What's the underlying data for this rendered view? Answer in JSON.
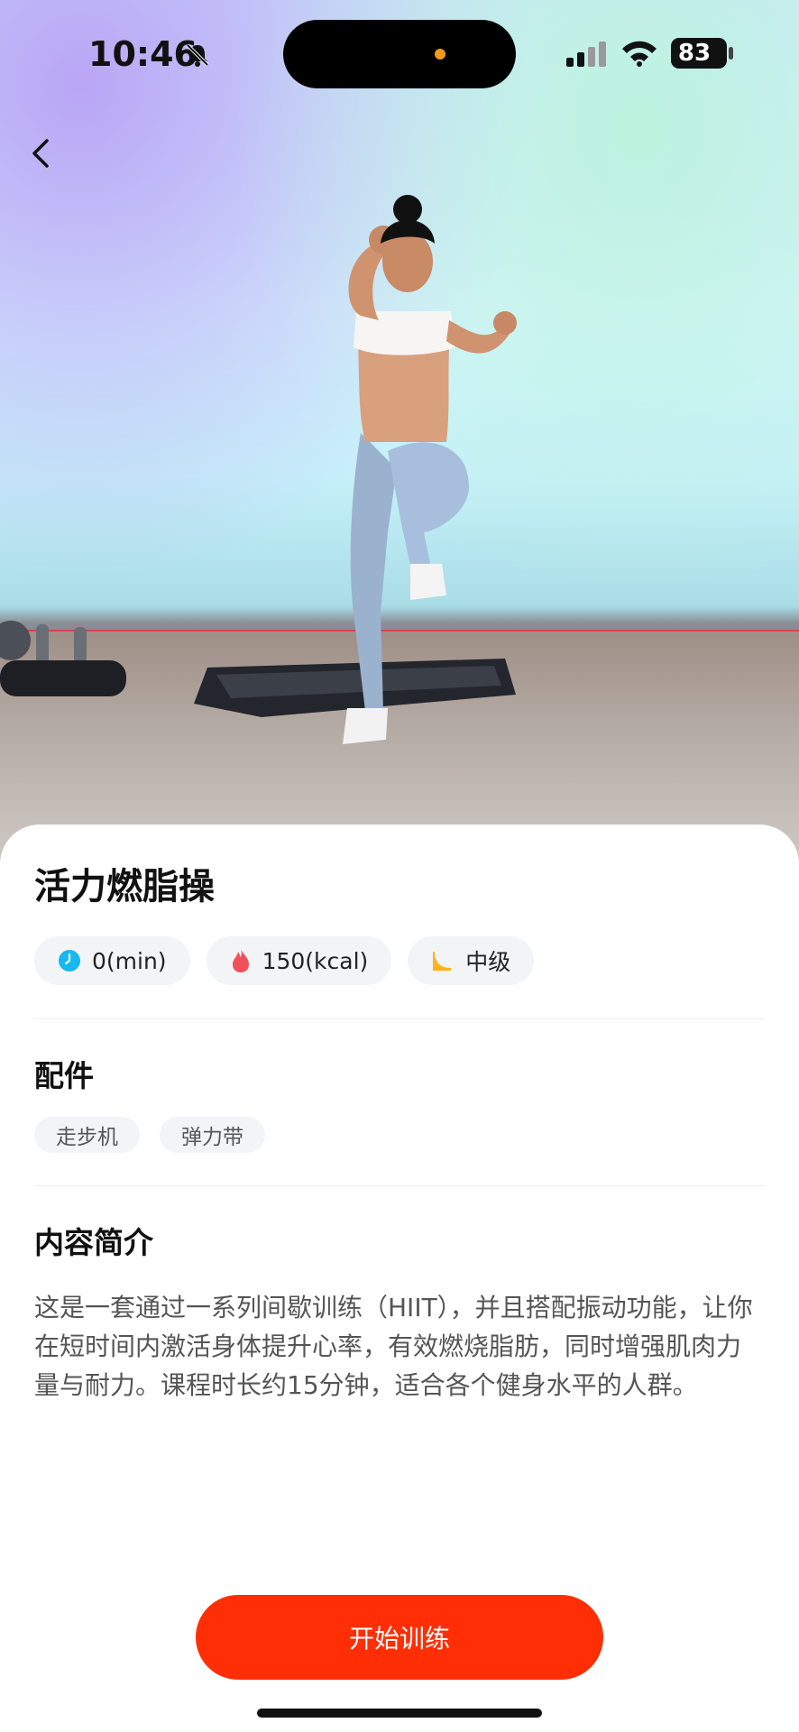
{
  "status_bar": {
    "time": "10:46",
    "battery": "83"
  },
  "course": {
    "title": "活力燃脂操",
    "stats": [
      {
        "icon": "clock-icon",
        "label": "0(min)",
        "color": "#17b7f0"
      },
      {
        "icon": "flame-icon",
        "label": "150(kcal)",
        "color": "#f2515c"
      },
      {
        "icon": "level-icon",
        "label": "中级",
        "color": "#ffb319"
      }
    ]
  },
  "accessories": {
    "heading": "配件",
    "items": [
      "走步机",
      "弹力带"
    ]
  },
  "intro": {
    "heading": "内容简介",
    "text": "这是一套通过一系列间歇训练（HIIT），并且搭配振动功能，让你在短时间内激活身体提升心率，有效燃烧脂肪，同时增强肌肉力量与耐力。课程时长约15分钟，适合各个健身水平的人群。"
  },
  "action": {
    "start_label": "开始训练"
  },
  "colors": {
    "accent": "#ff2e05"
  }
}
